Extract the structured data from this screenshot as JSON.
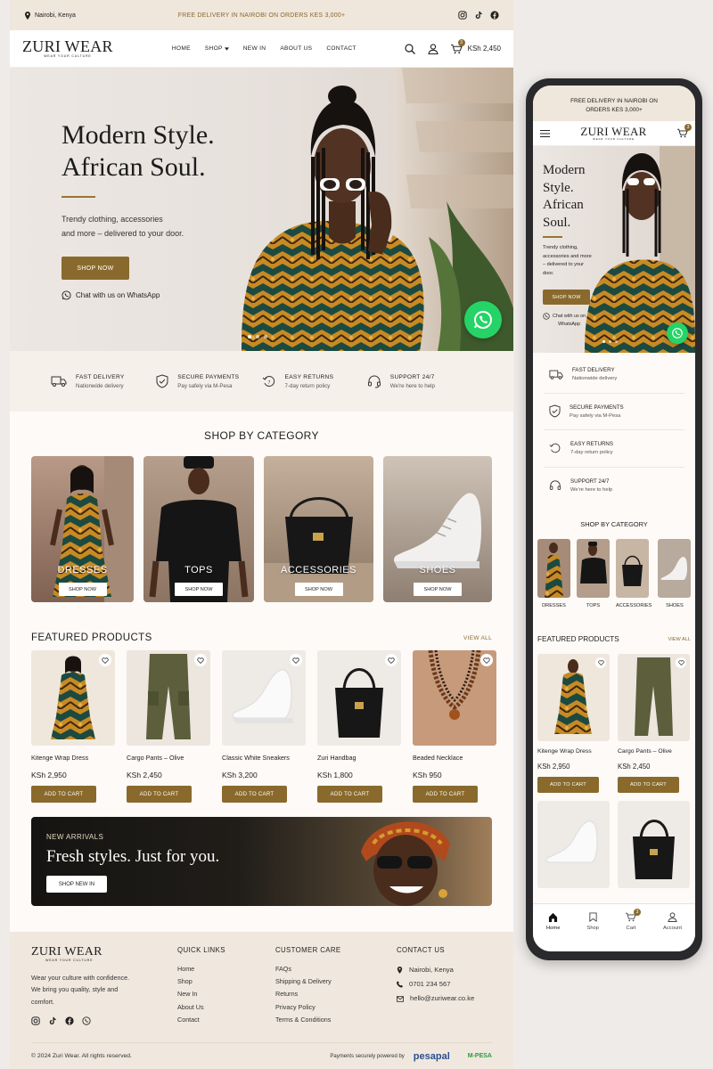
{
  "topbar": {
    "location": "Nairobi, Kenya",
    "promo": "FREE DELIVERY IN NAIROBI ON ORDERS KES 3,000+"
  },
  "brand": {
    "name": "ZURI WEAR",
    "tagline": "WEAR YOUR CULTURE"
  },
  "nav": {
    "items": [
      "HOME",
      "SHOP",
      "NEW IN",
      "ABOUT US",
      "CONTACT"
    ],
    "cart_total": "KSh 2,450",
    "cart_count": "3"
  },
  "hero": {
    "line1": "Modern Style.",
    "line2": "African Soul.",
    "sub1": "Trendy clothing, accessories",
    "sub2": "and more – delivered to your door.",
    "cta": "SHOP NOW",
    "whatsapp": "Chat with us on WhatsApp"
  },
  "features": [
    {
      "title": "FAST DELIVERY",
      "sub": "Nationwide delivery"
    },
    {
      "title": "SECURE PAYMENTS",
      "sub": "Pay safely via M-Pesa"
    },
    {
      "title": "EASY RETURNS",
      "sub": "7-day return policy"
    },
    {
      "title": "SUPPORT 24/7",
      "sub": "We're here to help"
    }
  ],
  "categories": {
    "title": "SHOP BY CATEGORY",
    "button": "SHOP NOW",
    "items": [
      "DRESSES",
      "TOPS",
      "ACCESSORIES",
      "SHOES"
    ]
  },
  "featured": {
    "title": "FEATURED PRODUCTS",
    "view_all": "VIEW ALL",
    "add_label": "ADD TO CART",
    "products": [
      {
        "name": "Kitenge Wrap Dress",
        "price": "KSh 2,950"
      },
      {
        "name": "Cargo Pants – Olive",
        "price": "KSh 2,450"
      },
      {
        "name": "Classic White Sneakers",
        "price": "KSh 3,200"
      },
      {
        "name": "Zuri Handbag",
        "price": "KSh 1,800"
      },
      {
        "name": "Beaded Necklace",
        "price": "KSh 950"
      }
    ]
  },
  "new_arrivals": {
    "kicker": "NEW ARRIVALS",
    "headline": "Fresh styles. Just for you.",
    "cta": "SHOP NEW IN"
  },
  "footer": {
    "about": "Wear your culture with confidence. We bring you quality, style and comfort.",
    "quick_title": "QUICK LINKS",
    "quick": [
      "Home",
      "Shop",
      "New In",
      "About Us",
      "Contact"
    ],
    "care_title": "CUSTOMER CARE",
    "care": [
      "FAQs",
      "Shipping & Delivery",
      "Returns",
      "Privacy Policy",
      "Terms & Conditions"
    ],
    "contact_title": "CONTACT US",
    "city": "Nairobi, Kenya",
    "phone": "0701 234 567",
    "email": "hello@zuriwear.co.ke",
    "copyright": "© 2024 Zuri Wear. All rights reserved.",
    "payments": "Payments securely powered by",
    "pesapal": "pesapal",
    "mpesa": "M-PESA"
  },
  "mobile": {
    "promo1": "FREE DELIVERY IN NAIROBI ON",
    "promo2": "ORDERS KES 3,000+",
    "hero_lines": [
      "Modern",
      "Style.",
      "African",
      "Soul."
    ],
    "hero_sub": "Trendy clothing, accessories and more – delivered to your door.",
    "wa1": "Chat with us on",
    "wa2": "WhatsApp",
    "tabs": [
      "Home",
      "Shop",
      "Cart",
      "Account"
    ]
  },
  "colors": {
    "accent": "#8a6a2c",
    "whatsapp": "#25d366",
    "topbar": "#efe6dc"
  }
}
